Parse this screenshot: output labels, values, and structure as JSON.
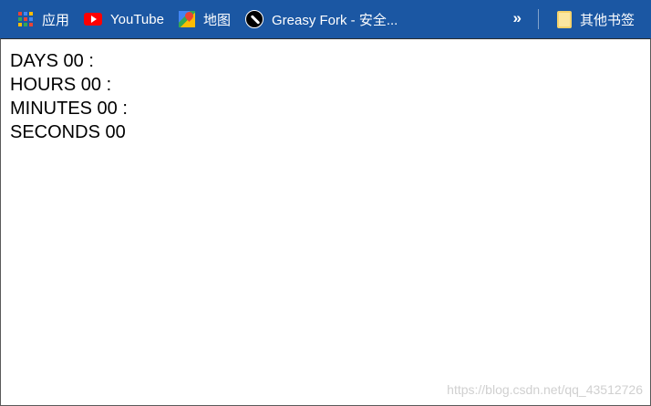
{
  "bookmarks": {
    "items": [
      {
        "label": "应用",
        "icon": "apps-grid-icon"
      },
      {
        "label": "YouTube",
        "icon": "youtube-icon"
      },
      {
        "label": "地图",
        "icon": "maps-icon"
      },
      {
        "label": "Greasy Fork - 安全...",
        "icon": "greasy-fork-icon"
      }
    ],
    "overflow": "»",
    "other_bookmarks": {
      "label": "其他书签",
      "icon": "folder-icon"
    },
    "colors": {
      "bar": "#1b57a3",
      "text": "#ffffff"
    }
  },
  "countdown": {
    "lines": [
      "DAYS 00 :",
      "HOURS 00 :",
      "MINUTES 00 :",
      "SECONDS 00"
    ]
  },
  "watermark": "https://blog.csdn.net/qq_43512726"
}
